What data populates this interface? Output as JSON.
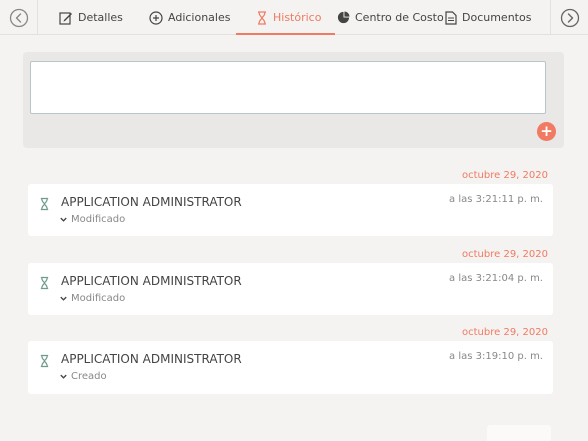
{
  "tabs": [
    {
      "label": "Detalles",
      "icon": "edit-icon",
      "active": false
    },
    {
      "label": "Adicionales",
      "icon": "plus-circle-icon",
      "active": false
    },
    {
      "label": "Histórico",
      "icon": "hourglass-icon",
      "active": true
    },
    {
      "label": "Centro de Costo",
      "icon": "pie-chart-icon",
      "active": false
    },
    {
      "label": "Documentos",
      "icon": "document-icon",
      "active": false
    }
  ],
  "comment": {
    "value": "",
    "add_icon": "+"
  },
  "history": [
    {
      "date": "octubre 29, 2020",
      "user": "APPLICATION ADMINISTRATOR",
      "time": "a las 3:21:11 p. m.",
      "action": "Modificado"
    },
    {
      "date": "octubre 29, 2020",
      "user": "APPLICATION ADMINISTRATOR",
      "time": "a las 3:21:04 p. m.",
      "action": "Modificado"
    },
    {
      "date": "octubre 29, 2020",
      "user": "APPLICATION ADMINISTRATOR",
      "time": "a las 3:19:10 p. m.",
      "action": "Creado"
    }
  ],
  "colors": {
    "accent": "#f07a62",
    "background": "#f4f3f1",
    "card": "#ffffff"
  }
}
